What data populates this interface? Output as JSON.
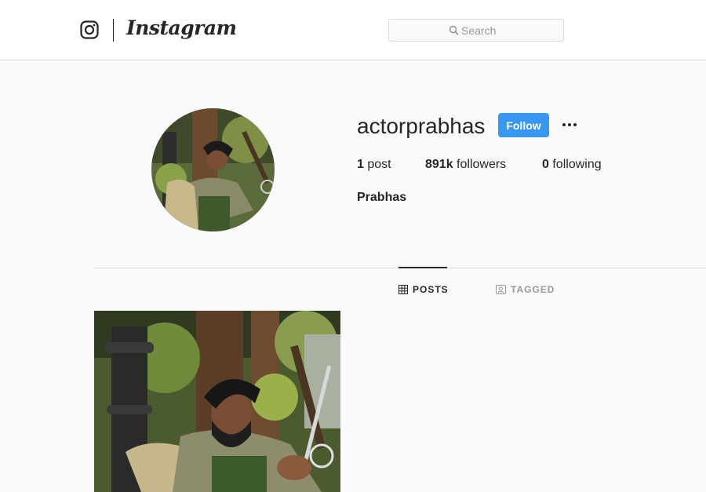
{
  "nav": {
    "logo_icon": "instagram-glyph-icon",
    "wordmark": "Instagram",
    "search": {
      "placeholder": "Search",
      "value": "",
      "icon": "search-icon"
    }
  },
  "profile": {
    "username": "actorprabhas",
    "follow_label": "Follow",
    "more_icon": "more-options-icon",
    "stats": {
      "posts": {
        "count": "1",
        "label": "post"
      },
      "followers": {
        "count": "891k",
        "label": "followers"
      },
      "following": {
        "count": "0",
        "label": "following"
      }
    },
    "full_name": "Prabhas"
  },
  "tabs": [
    {
      "label": "POSTS",
      "icon": "grid-icon",
      "active": true
    },
    {
      "label": "TAGGED",
      "icon": "tagged-icon",
      "active": false
    }
  ],
  "posts": [
    {
      "kind": "photo",
      "description_icon": "post-photo"
    }
  ],
  "colors": {
    "accent": "#3897f0",
    "text": "#262626",
    "muted": "#999999",
    "border": "#dbdbdb",
    "background": "#fafafa"
  }
}
